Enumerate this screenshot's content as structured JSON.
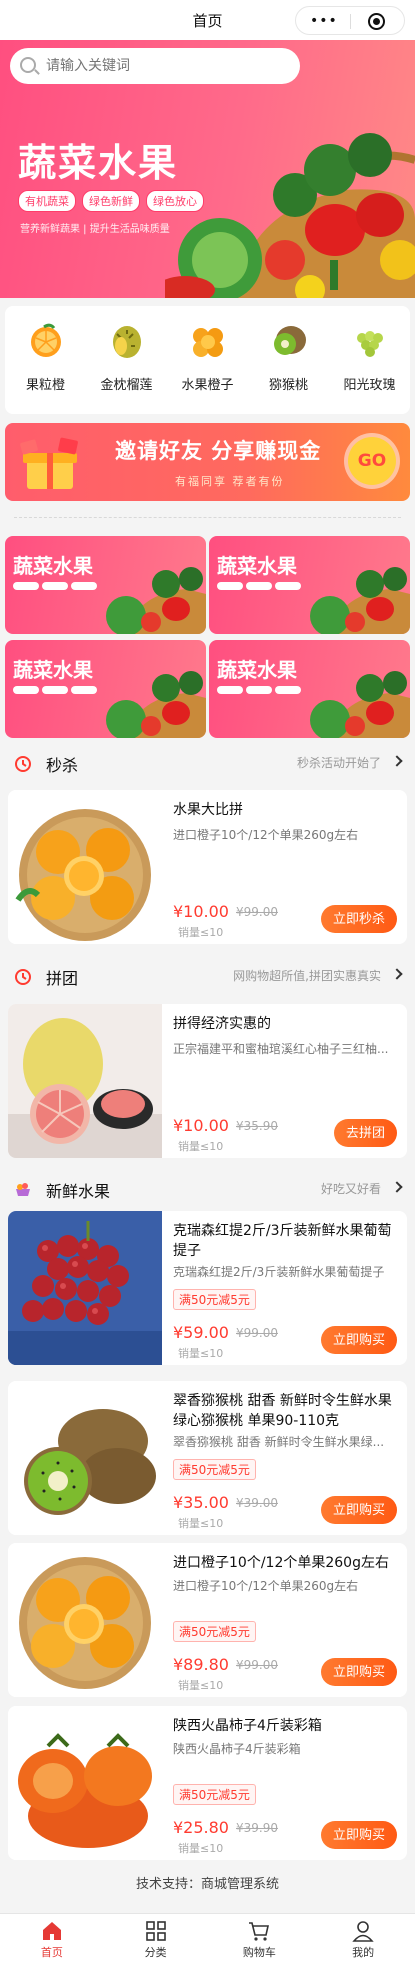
{
  "navbar": {
    "title": "首页"
  },
  "search": {
    "placeholder": "请输入关键词"
  },
  "banner": {
    "title": "蔬菜水果",
    "tags": [
      "有机蔬菜",
      "绿色新鲜",
      "绿色放心"
    ],
    "slogan": "营养新鲜蔬果 | 提升生活品味质量"
  },
  "categories": [
    {
      "label": "果粒橙",
      "icon": "orange-slice-icon"
    },
    {
      "label": "金枕榴莲",
      "icon": "durian-icon"
    },
    {
      "label": "水果橙子",
      "icon": "oranges-icon"
    },
    {
      "label": "猕猴桃",
      "icon": "kiwi-icon"
    },
    {
      "label": "阳光玫瑰",
      "icon": "grape-icon"
    }
  ],
  "invite": {
    "title": "邀请好友 分享赚现金",
    "subtitle": "有福同享 荐者有份",
    "go": "GO"
  },
  "promo_title": "蔬菜水果",
  "sections": {
    "seckill": {
      "title": "秒杀",
      "desc": "秒杀活动开始了"
    },
    "group": {
      "title": "拼团",
      "desc": "网购物超所值,拼团实惠真实"
    },
    "fresh": {
      "title": "新鲜水果",
      "desc": "好吃又好看"
    }
  },
  "seckill_product": {
    "name": "水果大比拼",
    "sub": "进口橙子10个/12个单果260g左右",
    "price": "¥10.00",
    "original_price": "¥99.00",
    "sales": "销量≤10",
    "button": "立即秒杀"
  },
  "group_product": {
    "name": "拼得经济实惠的",
    "sub": "正宗福建平和蜜柚琯溪红心柚子三红柚...",
    "price": "¥10.00",
    "original_price": "¥35.90",
    "sales": "销量≤10",
    "button": "去拼团"
  },
  "fresh_products": [
    {
      "name": "克瑞森红提2斤/3斤装新鲜水果葡萄提子",
      "sub": "克瑞森红提2斤/3斤装新鲜水果葡萄提子",
      "coupon": "满50元减5元",
      "price": "¥59.00",
      "original_price": "¥99.00",
      "sales": "销量≤10",
      "button": "立即购买"
    },
    {
      "name": "翠香猕猴桃 甜香 新鲜时令生鲜水果绿心猕猴桃 单果90-110克",
      "sub": "翠香猕猴桃 甜香 新鲜时令生鲜水果绿...",
      "coupon": "满50元减5元",
      "price": "¥35.00",
      "original_price": "¥39.00",
      "sales": "销量≤10",
      "button": "立即购买"
    },
    {
      "name": "进口橙子10个/12个单果260g左右",
      "sub": "进口橙子10个/12个单果260g左右",
      "coupon": "满50元减5元",
      "price": "¥89.80",
      "original_price": "¥99.00",
      "sales": "销量≤10",
      "button": "立即购买"
    },
    {
      "name": "陕西火晶柿子4斤装彩箱",
      "sub": "陕西火晶柿子4斤装彩箱",
      "coupon": "满50元减5元",
      "price": "¥25.80",
      "original_price": "¥39.90",
      "sales": "销量≤10",
      "button": "立即购买"
    }
  ],
  "footer": {
    "support": "技术支持：商城管理系统"
  },
  "tabbar": [
    {
      "label": "首页",
      "icon": "home-icon",
      "active": true
    },
    {
      "label": "分类",
      "icon": "grid-icon",
      "active": false
    },
    {
      "label": "购物车",
      "icon": "cart-icon",
      "active": false
    },
    {
      "label": "我的",
      "icon": "user-icon",
      "active": false
    }
  ],
  "colors": {
    "accent": "#ff5a14",
    "price": "#ff3b30",
    "banner": "#ff4f80",
    "tab_active": "#e53935"
  }
}
